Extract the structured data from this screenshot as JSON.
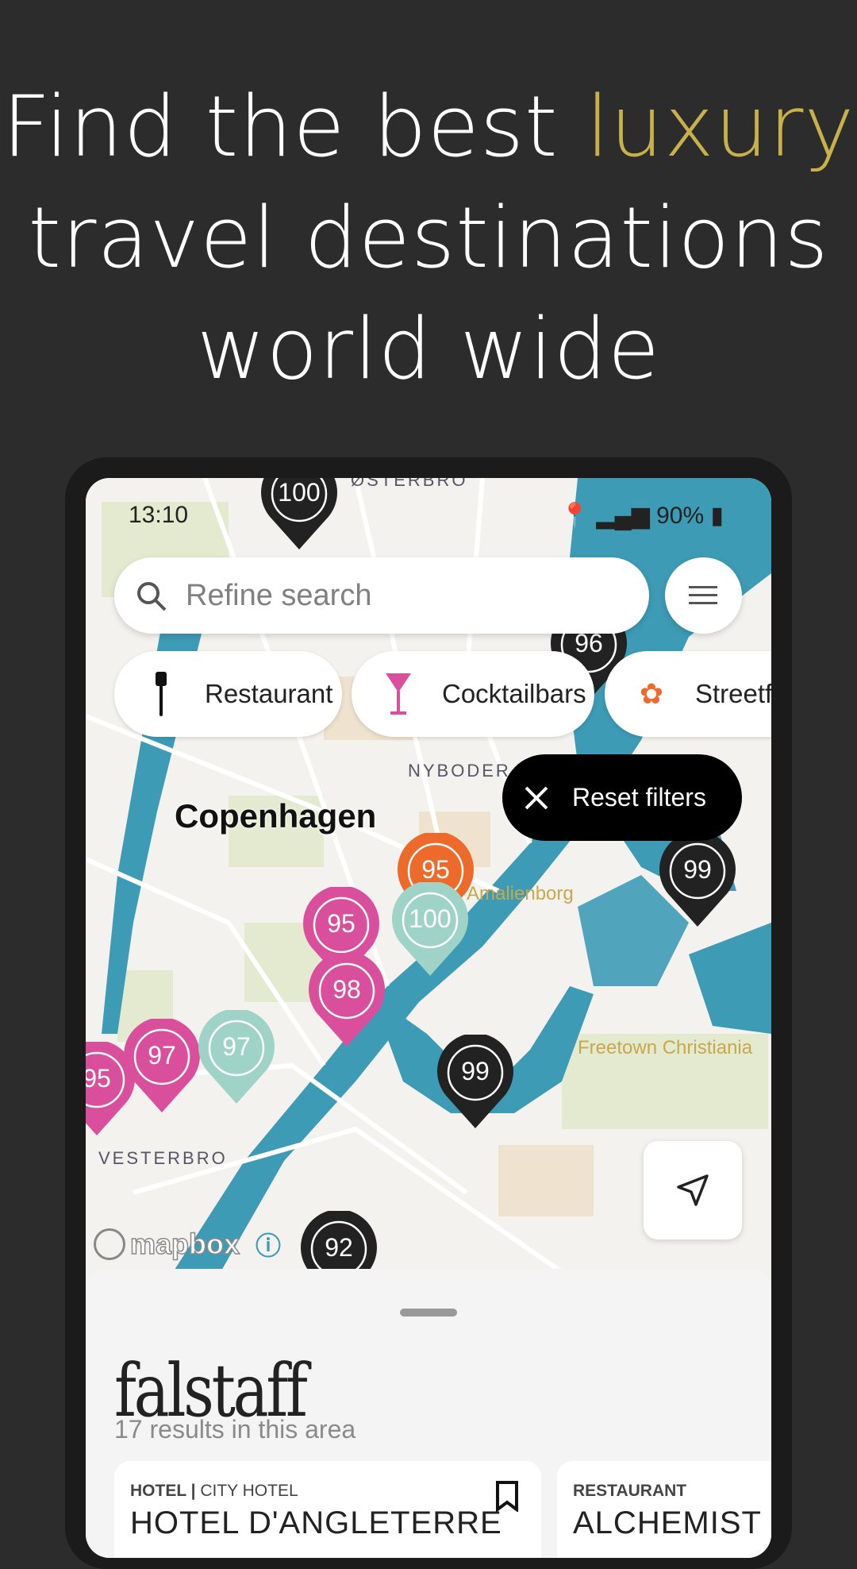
{
  "headline": {
    "part1": "Find the best ",
    "accent": "luxury",
    "line2": "travel destinations",
    "line3": "world wide",
    "accent_color": "#c8b04a"
  },
  "status_bar": {
    "time": "13:10",
    "battery": "90%"
  },
  "search": {
    "placeholder": "Refine search"
  },
  "chips": [
    {
      "label": "Restaurant",
      "icon": "fork-icon"
    },
    {
      "label": "Cocktailbars",
      "icon": "cocktail-glass-icon"
    },
    {
      "label": "Streetfo",
      "icon": "flower-icon"
    }
  ],
  "reset_filters": {
    "label": "Reset filters"
  },
  "map": {
    "labels": {
      "city": "Copenhagen",
      "nyboder": "NYBODER",
      "osterbro": "ØSTERBRO",
      "vesterbro": "VESTERBRO",
      "amalienborg": "Amalienborg",
      "christiania": "Freetown Christiania"
    },
    "attribution": "mapbox",
    "pins": [
      {
        "score": "100",
        "color": "#222222"
      },
      {
        "score": "96",
        "color": "#222222"
      },
      {
        "score": "95",
        "color": "#ee6a2a"
      },
      {
        "score": "100",
        "color": "#9fd3c7"
      },
      {
        "score": "95",
        "color": "#d94f9b"
      },
      {
        "score": "98",
        "color": "#d94f9b"
      },
      {
        "score": "97",
        "color": "#d94f9b"
      },
      {
        "score": "95",
        "color": "#d94f9b"
      },
      {
        "score": "97",
        "color": "#9fd3c7"
      },
      {
        "score": "99",
        "color": "#222222"
      },
      {
        "score": "99",
        "color": "#222222"
      },
      {
        "score": "92",
        "color": "#222222"
      }
    ]
  },
  "sheet": {
    "brand": "falstaff",
    "results": "17 results in this area",
    "cards": [
      {
        "category": "HOTEL",
        "subcategory": "CITY HOTEL",
        "name": "HOTEL D'ANGLETERRE"
      },
      {
        "category": "RESTAURANT",
        "name": "ALCHEMIST"
      }
    ]
  }
}
